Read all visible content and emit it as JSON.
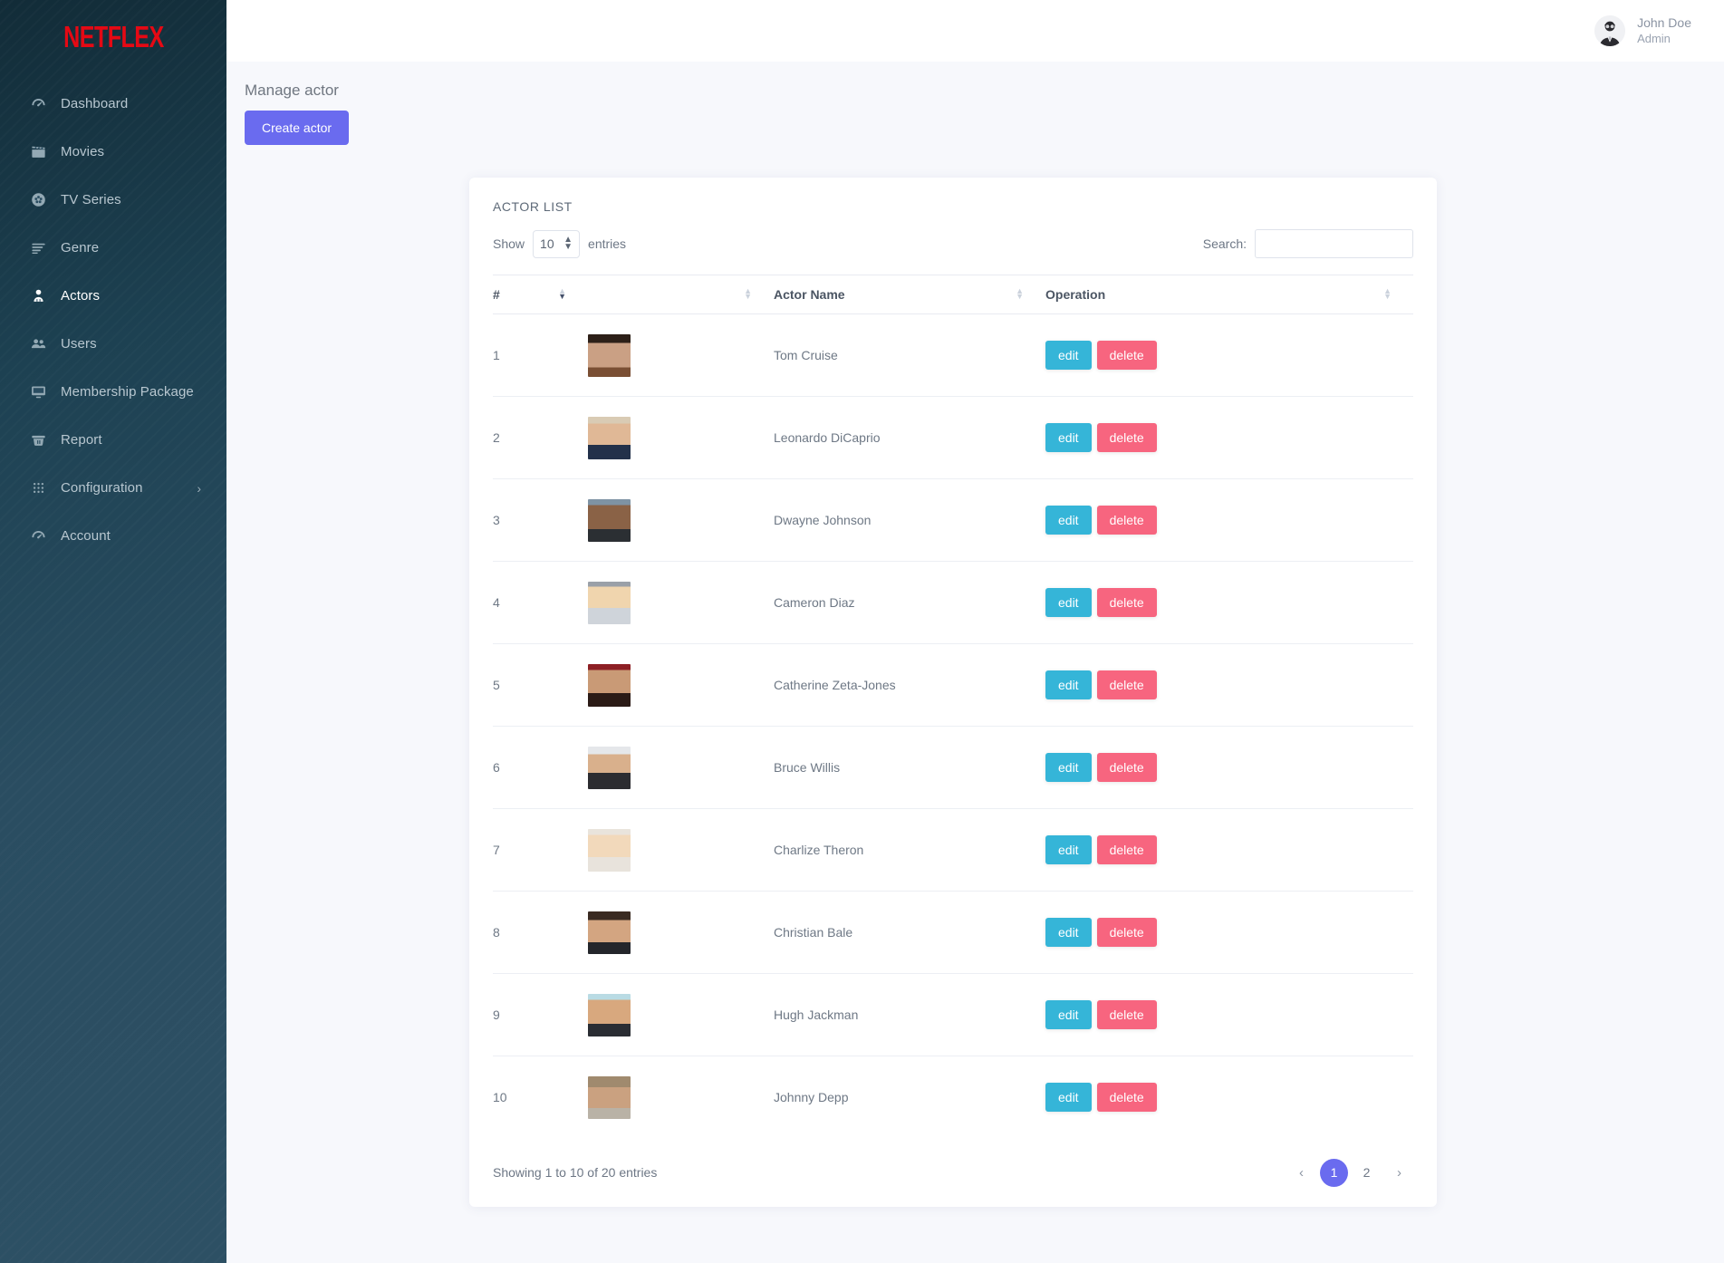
{
  "sidebar": {
    "brand": "NETFLEX",
    "items": [
      {
        "label": "Dashboard",
        "icon": "speedometer-icon",
        "active": false,
        "caret": ""
      },
      {
        "label": "Movies",
        "icon": "clapperboard-icon",
        "active": false,
        "caret": ""
      },
      {
        "label": "TV Series",
        "icon": "film-reel-icon",
        "active": false,
        "caret": ""
      },
      {
        "label": "Genre",
        "icon": "list-lines-icon",
        "active": false,
        "caret": ""
      },
      {
        "label": "Actors",
        "icon": "person-icon",
        "active": true,
        "caret": ""
      },
      {
        "label": "Users",
        "icon": "people-icon",
        "active": false,
        "caret": ""
      },
      {
        "label": "Membership Package",
        "icon": "monitor-icon",
        "active": false,
        "caret": ""
      },
      {
        "label": "Report",
        "icon": "basket-icon",
        "active": false,
        "caret": ""
      },
      {
        "label": "Configuration",
        "icon": "grid-dots-icon",
        "active": false,
        "caret": "›"
      },
      {
        "label": "Account",
        "icon": "speedometer-icon",
        "active": false,
        "caret": ""
      }
    ]
  },
  "topbar": {
    "user_name": "John Doe",
    "user_role": "Admin"
  },
  "page": {
    "title": "Manage actor",
    "create_button": "Create actor"
  },
  "card": {
    "title": "ACTOR LIST",
    "show_label": "Show",
    "entries_label": "entries",
    "entries_value": "10",
    "search_label": "Search:",
    "search_value": "",
    "search_placeholder": "",
    "columns": [
      {
        "label": "#",
        "sorted": "desc"
      },
      {
        "label": "",
        "sorted": "none"
      },
      {
        "label": "Actor Name",
        "sorted": "none"
      },
      {
        "label": "Operation",
        "sorted": "none"
      }
    ],
    "rows": [
      {
        "num": "1",
        "name": "Tom Cruise",
        "edit": "edit",
        "delete": "delete"
      },
      {
        "num": "2",
        "name": "Leonardo DiCaprio",
        "edit": "edit",
        "delete": "delete"
      },
      {
        "num": "3",
        "name": "Dwayne Johnson",
        "edit": "edit",
        "delete": "delete"
      },
      {
        "num": "4",
        "name": "Cameron Diaz",
        "edit": "edit",
        "delete": "delete"
      },
      {
        "num": "5",
        "name": "Catherine Zeta-Jones",
        "edit": "edit",
        "delete": "delete"
      },
      {
        "num": "6",
        "name": "Bruce Willis",
        "edit": "edit",
        "delete": "delete"
      },
      {
        "num": "7",
        "name": "Charlize Theron",
        "edit": "edit",
        "delete": "delete"
      },
      {
        "num": "8",
        "name": "Christian Bale",
        "edit": "edit",
        "delete": "delete"
      },
      {
        "num": "9",
        "name": "Hugh Jackman",
        "edit": "edit",
        "delete": "delete"
      },
      {
        "num": "10",
        "name": "Johnny Depp",
        "edit": "edit",
        "delete": "delete"
      }
    ],
    "showing_text": "Showing 1 to 10 of 20 entries",
    "pagination": {
      "prev": "‹",
      "pages": [
        "1",
        "2"
      ],
      "active_page": "1",
      "next": "›"
    }
  },
  "colors": {
    "brand_red": "#e50914",
    "accent_purple": "#6a6bef",
    "edit_blue": "#35b5d8",
    "delete_pink": "#f7657f",
    "sidebar_top": "#122c38",
    "sidebar_bottom": "#2d5064",
    "page_bg": "#f7f8fc"
  }
}
